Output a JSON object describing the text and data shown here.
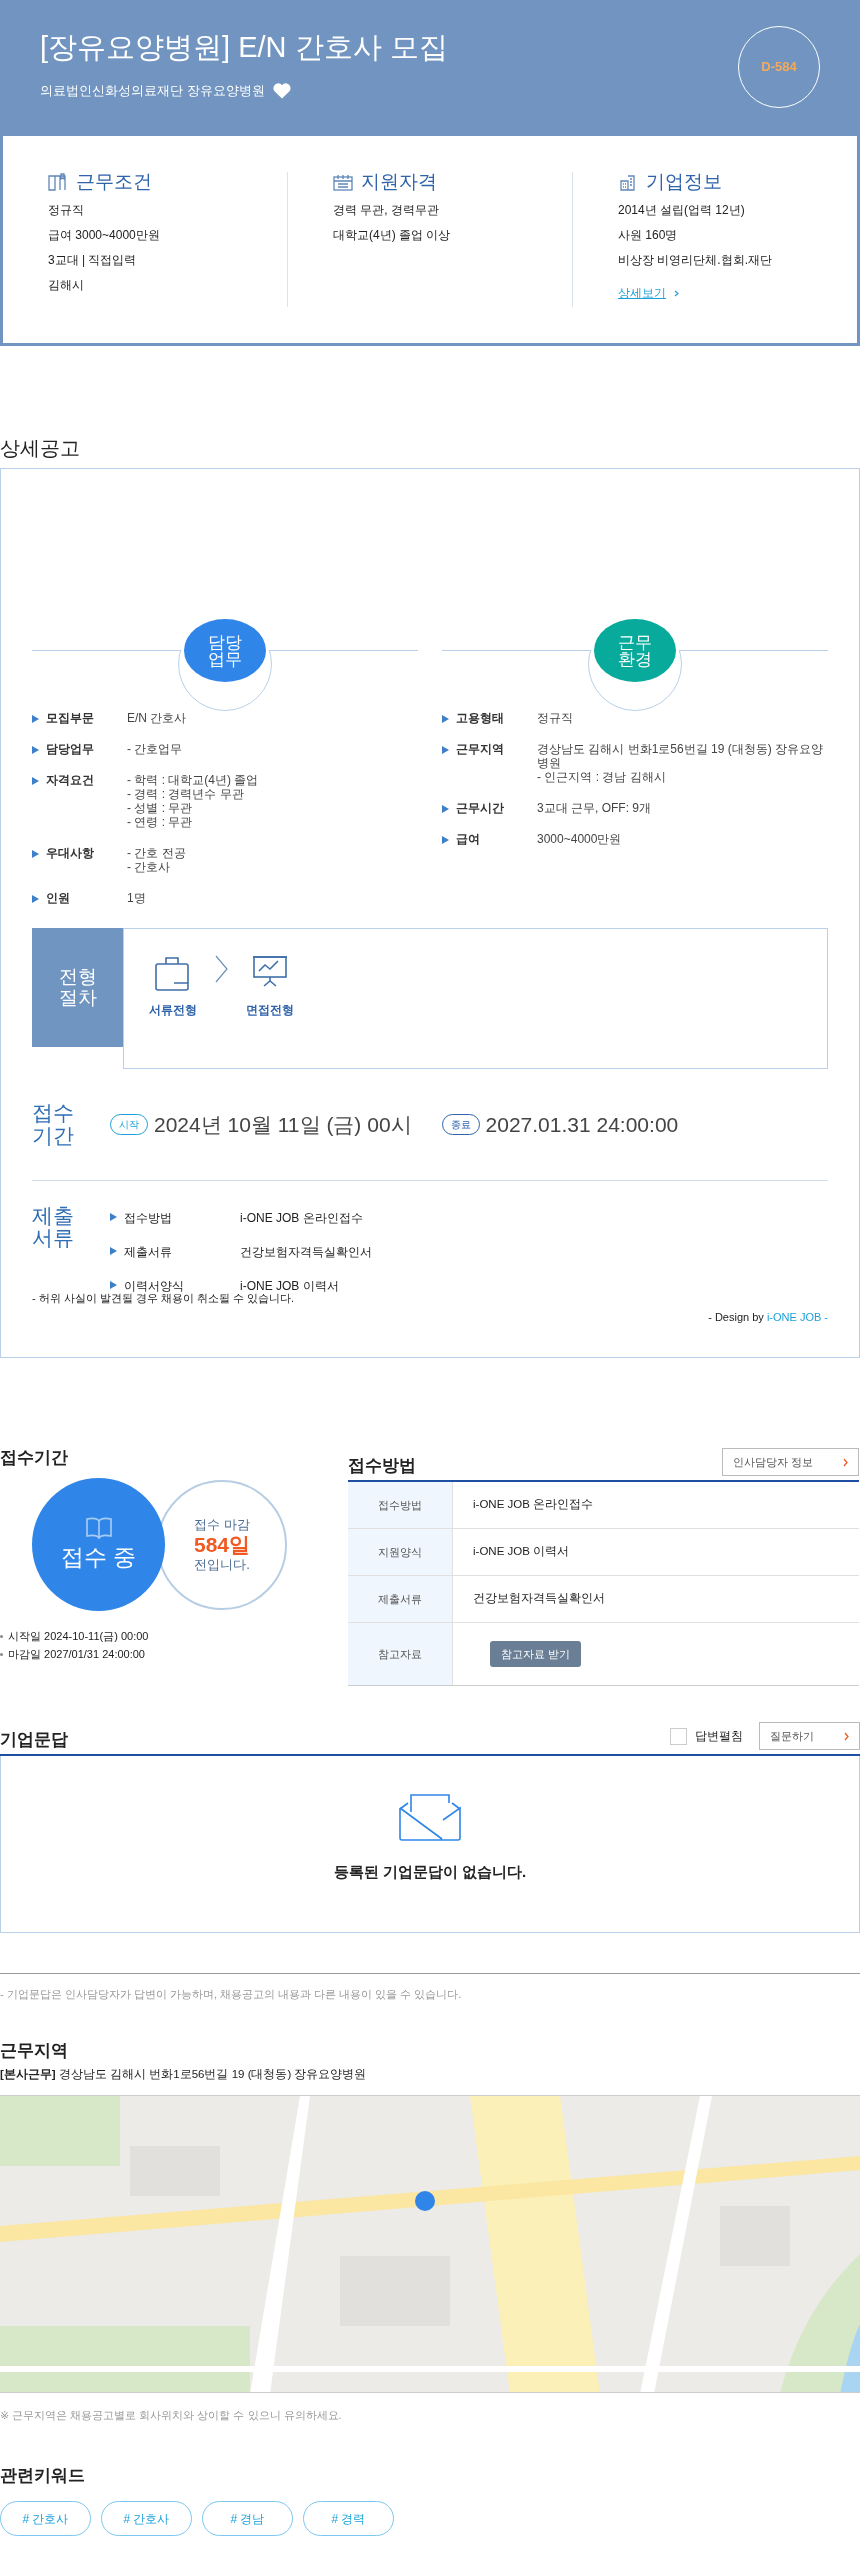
{
  "header": {
    "title": "[장유요양병원] E/N 간호사 모집",
    "company": "의료법인신화성의료재단 장유요양병원",
    "favorite": true,
    "dday": "D-584"
  },
  "summary": [
    {
      "title": "근무조건",
      "lines": [
        "정규직",
        "급여 3000~4000만원",
        "3교대 | 직접입력",
        "김해시"
      ]
    },
    {
      "title": "지원자격",
      "lines": [
        "경력 무관, 경력무관",
        "대학교(4년) 졸업 이상"
      ]
    },
    {
      "title": "기업정보",
      "lines": [
        "2014년 설립(업력 12년)",
        "사원 160명",
        "비상장 비영리단체.협회.재단"
      ],
      "link": "상세보기"
    }
  ],
  "detail": {
    "title": "상세공고",
    "columns": [
      {
        "badge": [
          "담당",
          "업무"
        ],
        "color": "#2f86e8",
        "rows": [
          {
            "label": "모집부문",
            "values": [
              "E/N 간호사"
            ]
          },
          {
            "label": "담당업무",
            "values": [
              "- 간호업무"
            ]
          },
          {
            "label": "자격요건",
            "values": [
              "- 학력 : 대학교(4년) 졸업",
              "- 경력 : 경력년수 무관",
              "- 성별 : 무관",
              "- 연령 : 무관"
            ]
          },
          {
            "label": "우대사항",
            "values": [
              "- 간호 전공",
              "- 간호사"
            ]
          },
          {
            "label": "인원",
            "values": [
              "1명"
            ]
          }
        ]
      },
      {
        "badge": [
          "근무",
          "환경"
        ],
        "color": "#07aa9b",
        "rows": [
          {
            "label": "고용형태",
            "values": [
              "정규직"
            ]
          },
          {
            "label": "근무지역",
            "values": [
              "경상남도 김해시 번화1로56번길 19 (대청동) 장유요양병원",
              "- 인근지역 : 경남 김해시"
            ]
          },
          {
            "label": "근무시간",
            "values": [
              "3교대 근무, OFF: 9개"
            ]
          },
          {
            "label": "급여",
            "values": [
              "3000~4000만원"
            ]
          }
        ]
      }
    ],
    "process": {
      "label": [
        "전형",
        "절차"
      ],
      "steps": [
        "서류전형",
        "면접전형"
      ]
    },
    "period": {
      "label": [
        "접수",
        "기간"
      ],
      "start_tag": "시작",
      "start": "2024년 10월 11일 (금) 00시",
      "end_tag": "종료",
      "end": "2027.01.31 24:00:00"
    },
    "documents": {
      "label": [
        "제출",
        "서류"
      ],
      "rows": [
        {
          "label": "접수방법",
          "value": "i-ONE JOB 온라인접수"
        },
        {
          "label": "제출서류",
          "value": "건강보험자격득실확인서"
        },
        {
          "label": "이력서양식",
          "value": "i-ONE JOB 이력서"
        }
      ]
    },
    "notice": "- 허위 사실이 발견될 경우 채용이 취소될 수 있습니다.",
    "design_by": "- Design by ",
    "design_brand": "i-ONE JOB -"
  },
  "receipt": {
    "title": "접수기간",
    "status": "접수 중",
    "remain_top": "접수 마감",
    "days": "584일",
    "remain_bottom": "전입니다.",
    "dates": [
      "시작일 2024-10-11(금) 00:00",
      "마감일 2027/01/31 24:00:00"
    ]
  },
  "method": {
    "title": "접수방법",
    "button": "인사담당자 정보",
    "rows": [
      {
        "label": "접수방법",
        "kind": "text",
        "value": "i-ONE JOB 온라인접수"
      },
      {
        "label": "지원양식",
        "kind": "text",
        "value": "i-ONE JOB 이력서"
      },
      {
        "label": "제출서류",
        "kind": "text",
        "value": "건강보험자격득실확인서"
      },
      {
        "label": "참고자료",
        "kind": "button",
        "value": "참고자료 받기"
      }
    ]
  },
  "qna": {
    "title": "기업문답",
    "toggle": {
      "label": "답변펼침",
      "checked": false
    },
    "button": "질문하기",
    "empty": "등록된 기업문답이 없습니다.",
    "note": "- 기업문답은 인사담당자가 답변이 가능하며, 채용공고의 내용과 다른 내용이 있을 수 있습니다."
  },
  "location": {
    "title": "근무지역",
    "address": "**[본사근무]** 경상남도 김해시 번화1로56번길 19 (대청동) 장유요양병원",
    "note": "※ 근무지역은 채용공고별로 회사위치와 상이할 수 있으니 유의하세요."
  },
  "keywords": {
    "title": "관련키워드",
    "tags": [
      "# 간호사",
      "# 간호사",
      "# 경남",
      "# 경력"
    ]
  }
}
